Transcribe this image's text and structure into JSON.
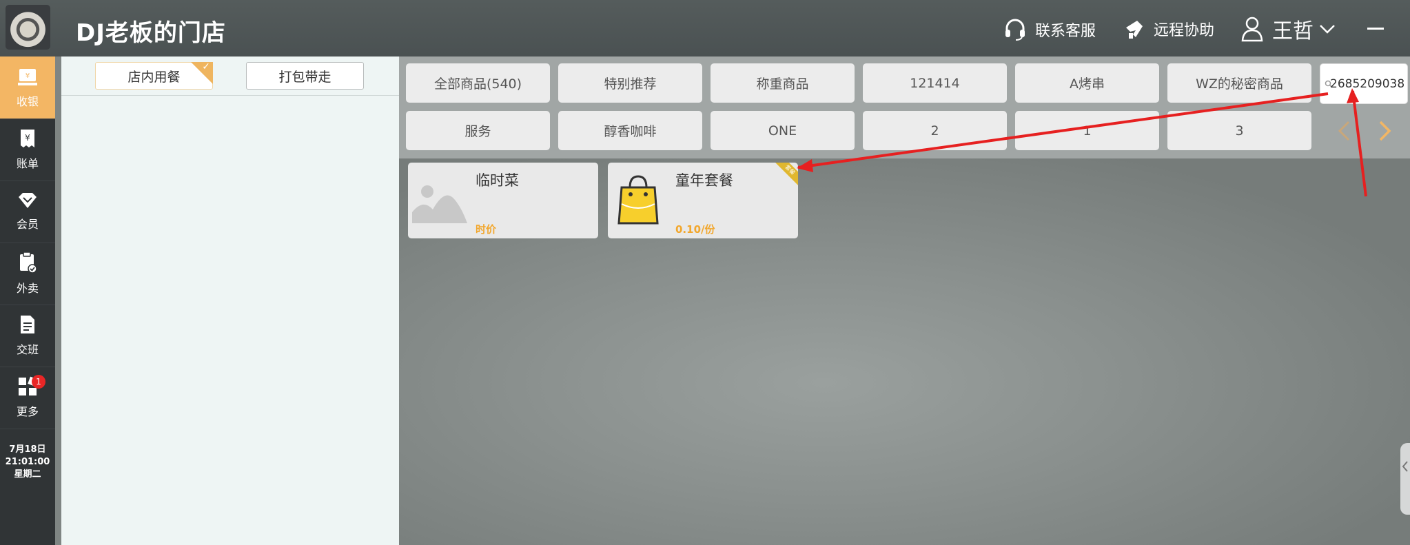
{
  "header": {
    "store_title": "DJ老板的门店",
    "support_label": "联系客服",
    "remote_label": "远程协助",
    "user_name": "王哲"
  },
  "nav": {
    "items": [
      {
        "label": "收银",
        "icon": "cashier-icon"
      },
      {
        "label": "账单",
        "icon": "bill-icon"
      },
      {
        "label": "会员",
        "icon": "diamond-icon"
      },
      {
        "label": "外卖",
        "icon": "takeout-icon"
      },
      {
        "label": "交班",
        "icon": "handover-icon"
      },
      {
        "label": "更多",
        "icon": "grid-more-icon"
      }
    ],
    "more_badge": "1",
    "clock": {
      "date": "7月18日",
      "time": "21:01:00",
      "weekday": "星期二"
    }
  },
  "order": {
    "tabs": [
      "店内用餐",
      "打包带走"
    ]
  },
  "categories": {
    "row1": [
      "全部商品(540)",
      "特别推荐",
      "称重商品",
      "121414",
      "A烤串",
      "WZ的秘密商品"
    ],
    "row2": [
      "服务",
      "醇香咖啡",
      "ONE",
      "2",
      "1",
      "3"
    ],
    "search_value": "2685209038"
  },
  "products": [
    {
      "name": "临时菜",
      "price": "时价"
    },
    {
      "name": "童年套餐",
      "price": "0.10/份",
      "ribbon": "套餐"
    }
  ],
  "colors": {
    "accent": "#f3b664",
    "price": "#f2a72d",
    "annotation": "#e62020"
  }
}
